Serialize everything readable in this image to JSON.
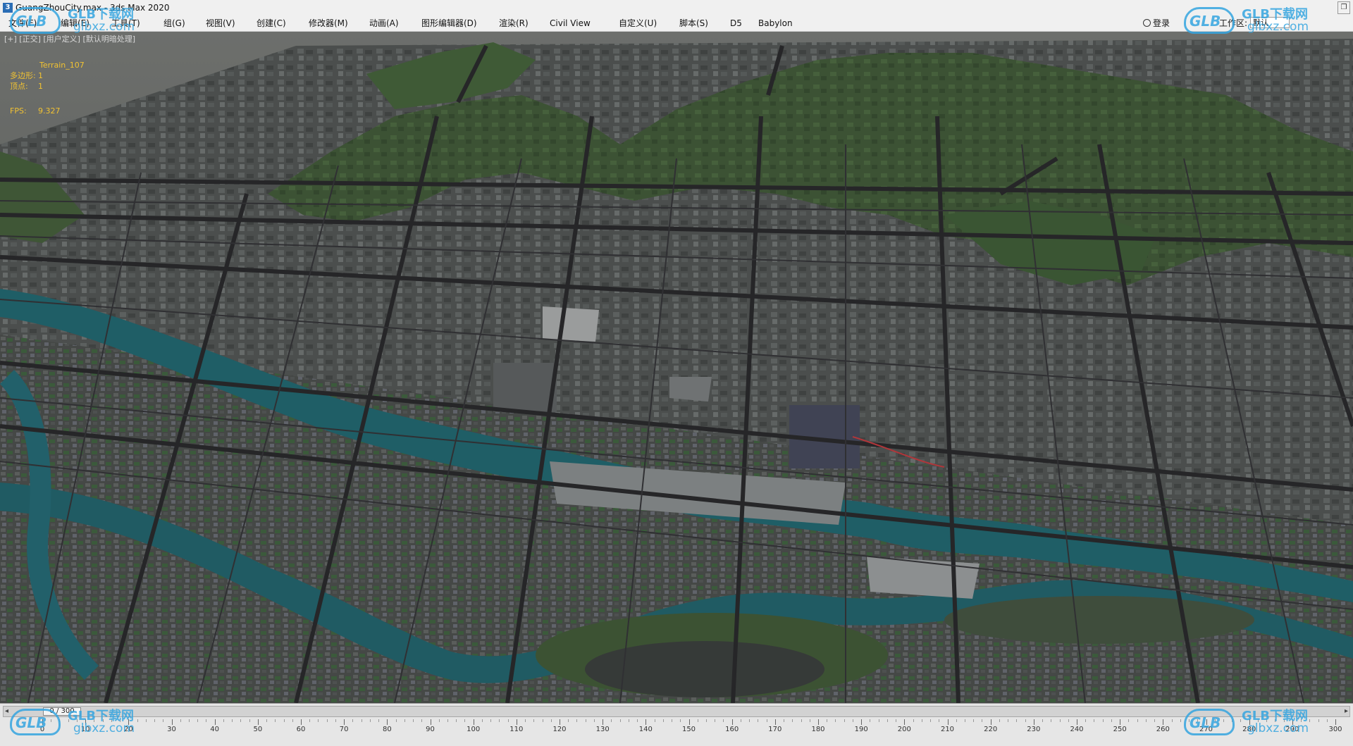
{
  "window": {
    "title": "GuangZhouCity.max - 3ds Max 2020",
    "app_icon_glyph": "3",
    "restore_glyph": "❐"
  },
  "menu": {
    "items": [
      "文件(F)",
      "编辑(E)",
      "工具(T)",
      "组(G)",
      "视图(V)",
      "创建(C)",
      "修改器(M)",
      "动画(A)",
      "图形编辑器(D)",
      "渲染(R)",
      "Civil View",
      "自定义(U)",
      "脚本(S)",
      "D5",
      "Babylon"
    ],
    "login": "登录",
    "workspace_label": "工作区:",
    "workspace_value": "默认"
  },
  "viewport": {
    "label": "[+] [正交] [用户定义] [默认明暗处理]",
    "object_name": "Terrain_107",
    "stats": [
      {
        "key": "多边形:",
        "value": "1"
      },
      {
        "key": "顶点:",
        "value": "1"
      }
    ],
    "fps_key": "FPS:",
    "fps_value": "9.327",
    "colors": {
      "stats_text": "#f1c232",
      "water": "#1f5e66",
      "vegetation": "#3d5a34",
      "urban": "#4a4d4c",
      "road": "#2b2b2d"
    }
  },
  "timeline": {
    "frame_display": "0 / 300",
    "ticks": [
      "0",
      "10",
      "20",
      "30",
      "40",
      "50",
      "60",
      "70",
      "80",
      "90",
      "100",
      "110",
      "120",
      "130",
      "140",
      "150",
      "160",
      "170",
      "180",
      "190",
      "200",
      "210",
      "220",
      "230",
      "240",
      "250",
      "260",
      "270",
      "280",
      "290",
      "300"
    ],
    "prev_glyph": "◂",
    "next_glyph": "▸"
  },
  "watermark": {
    "logo": "GLB",
    "cn": "GLB下载网",
    "url": "glbxz.com"
  }
}
